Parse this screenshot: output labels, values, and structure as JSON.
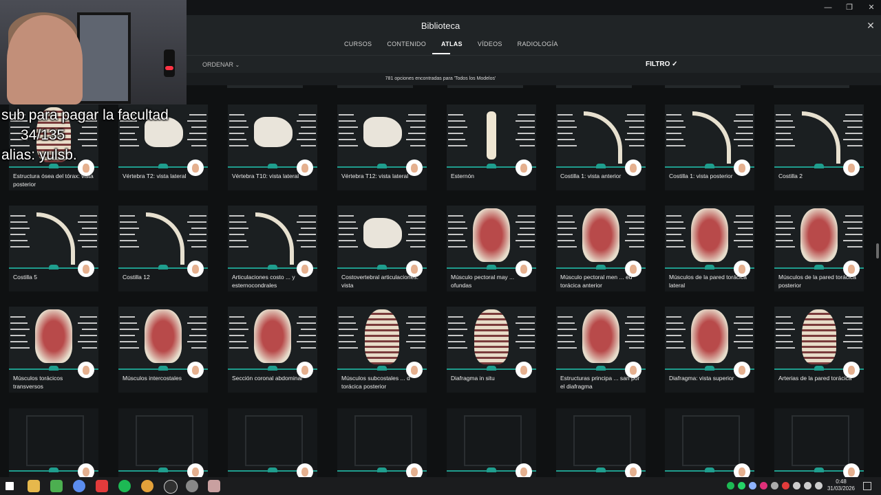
{
  "window": {
    "title": "Biblioteca",
    "controls": {
      "minimize": "—",
      "maximize": "❐",
      "close": "✕"
    }
  },
  "nav": {
    "tabs": [
      {
        "label": "CURSOS",
        "active": false
      },
      {
        "label": "CONTENIDO",
        "active": false
      },
      {
        "label": "ATLAS",
        "active": true
      },
      {
        "label": "VÍDEOS",
        "active": false
      },
      {
        "label": "RADIOLOGÍA",
        "active": false
      }
    ]
  },
  "toolbar": {
    "order_label": "ORDENAR",
    "order_icon": "chevron-down-icon",
    "filter_label": "FILTRO",
    "filter_icon": "check-icon"
  },
  "results": {
    "text": "781 opciones encontradas para 'Todos los Modelos'"
  },
  "grid": {
    "rows": [
      [
        {
          "label": "Estructura ósea del tórax: vista posterior",
          "model": "thorax"
        },
        {
          "label": "Vértebra T2: vista lateral",
          "model": "vertebra"
        },
        {
          "label": "Vértebra T10: vista lateral",
          "model": "vertebra"
        },
        {
          "label": "Vértebra T12: vista lateral",
          "model": "vertebra"
        },
        {
          "label": "Esternón",
          "model": "sternum"
        },
        {
          "label": "Costilla 1: vista anterior",
          "model": "rib"
        },
        {
          "label": "Costilla 1: vista posterior",
          "model": "rib"
        },
        {
          "label": "Costilla 2",
          "model": "rib"
        }
      ],
      [
        {
          "label": "Costilla 5",
          "model": "rib"
        },
        {
          "label": "Costilla 12",
          "model": "rib"
        },
        {
          "label": "Articulaciones costo ... y esternocondrales",
          "model": "rib"
        },
        {
          "label": "Costovertebral articulaciones: vista",
          "model": "vertebra"
        },
        {
          "label": "Músculo pectoral may ... ofundas",
          "model": "muscle"
        },
        {
          "label": "Músculo pectoral men ... ed torácica anterior",
          "model": "muscle"
        },
        {
          "label": "Músculos de la pared torácica lateral",
          "model": "muscle"
        },
        {
          "label": "Músculos de la pared torácica posterior",
          "model": "muscle"
        }
      ],
      [
        {
          "label": "Músculos torácicos transversos",
          "model": "muscle"
        },
        {
          "label": "Músculos intercostales",
          "model": "muscle"
        },
        {
          "label": "Sección coronal abdominal",
          "model": "muscle"
        },
        {
          "label": "Músculos subcostales ... d torácica posterior",
          "model": "thorax"
        },
        {
          "label": "Diafragma in situ",
          "model": "thorax"
        },
        {
          "label": "Estructuras principa ... san por el diafragma",
          "model": "muscle"
        },
        {
          "label": "Diafragma: vista superior",
          "model": "muscle"
        },
        {
          "label": "Arterias de la pared torácica",
          "model": "thorax"
        }
      ]
    ]
  },
  "overlay": {
    "line1": "sub para pagar la facultad",
    "line2": "34/135",
    "line3": "alias: yulsb."
  },
  "taskbar": {
    "time": "0:48",
    "date": "31/03/2026",
    "icons": [
      "windows-icon",
      "file-explorer-icon",
      "store-icon",
      "chrome-icon",
      "app-icon",
      "spotify-icon",
      "chrome-icon",
      "obs-icon",
      "settings-icon",
      "app-icon"
    ]
  }
}
